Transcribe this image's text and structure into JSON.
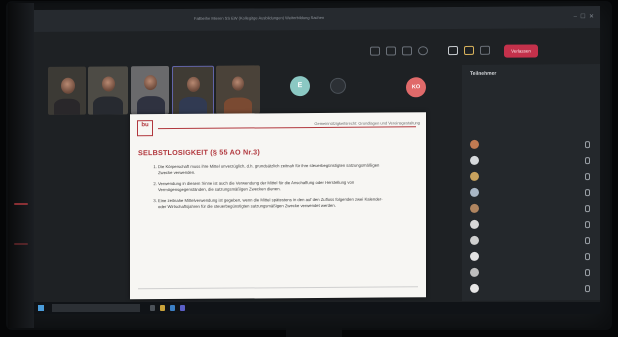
{
  "window": {
    "title": "Fallbeihe Mieren SS EW (Kollegitge Ausbildungen) Weiterbildung Sachen"
  },
  "call": {
    "leave_label": "Verlassen"
  },
  "slide": {
    "logo_text": "bu",
    "header_text": "Gemeinnützigkeitsrecht: Grundlagen und Vereinsgestaltung",
    "heading": "SELBSTLOSIGKEIT (§ 55 AO Nr.3)",
    "items": [
      "Die Körperschaft muss ihre Mittel unverzüglich, d.h. grundsätzlich zeitnah für ihre steuerbegünstigten satzungsmäßigen Zwecke verwenden.",
      "Verwendung in diesem Sinne ist auch die Verwendung der Mittel für die Anschaffung oder Herstellung von Vermögensgegenständen, die satzungsmäßigen Zwecken dienen.",
      "Eine zeitnahe Mittelverwendung ist gegeben, wenn die Mittel spätestens in den auf den Zufluss folgenden zwei Kalender- oder Wirtschaftsjahren für die steuerbegünstigten satzungsmäßigen Zwecke verwendet werden."
    ]
  },
  "participants": {
    "title": "Teilnehmer",
    "avatars": [
      {
        "initials": "E",
        "color": "#8bc8c3"
      },
      {
        "initials": "KO",
        "color": "#e06a6a"
      }
    ],
    "list": [
      {
        "color": "#c07a52"
      },
      {
        "color": "#d6d9dc"
      },
      {
        "color": "#c9a35e"
      },
      {
        "color": "#a8b6c4"
      },
      {
        "color": "#b08560"
      },
      {
        "color": "#d8d8d8"
      },
      {
        "color": "#cfcfcf"
      },
      {
        "color": "#e2e2e2"
      },
      {
        "color": "#bdbdbd"
      },
      {
        "color": "#e6e6e6"
      }
    ]
  },
  "colors": {
    "accent": "#b1373d",
    "leave": "#c4314b",
    "window": "#1e2124"
  }
}
